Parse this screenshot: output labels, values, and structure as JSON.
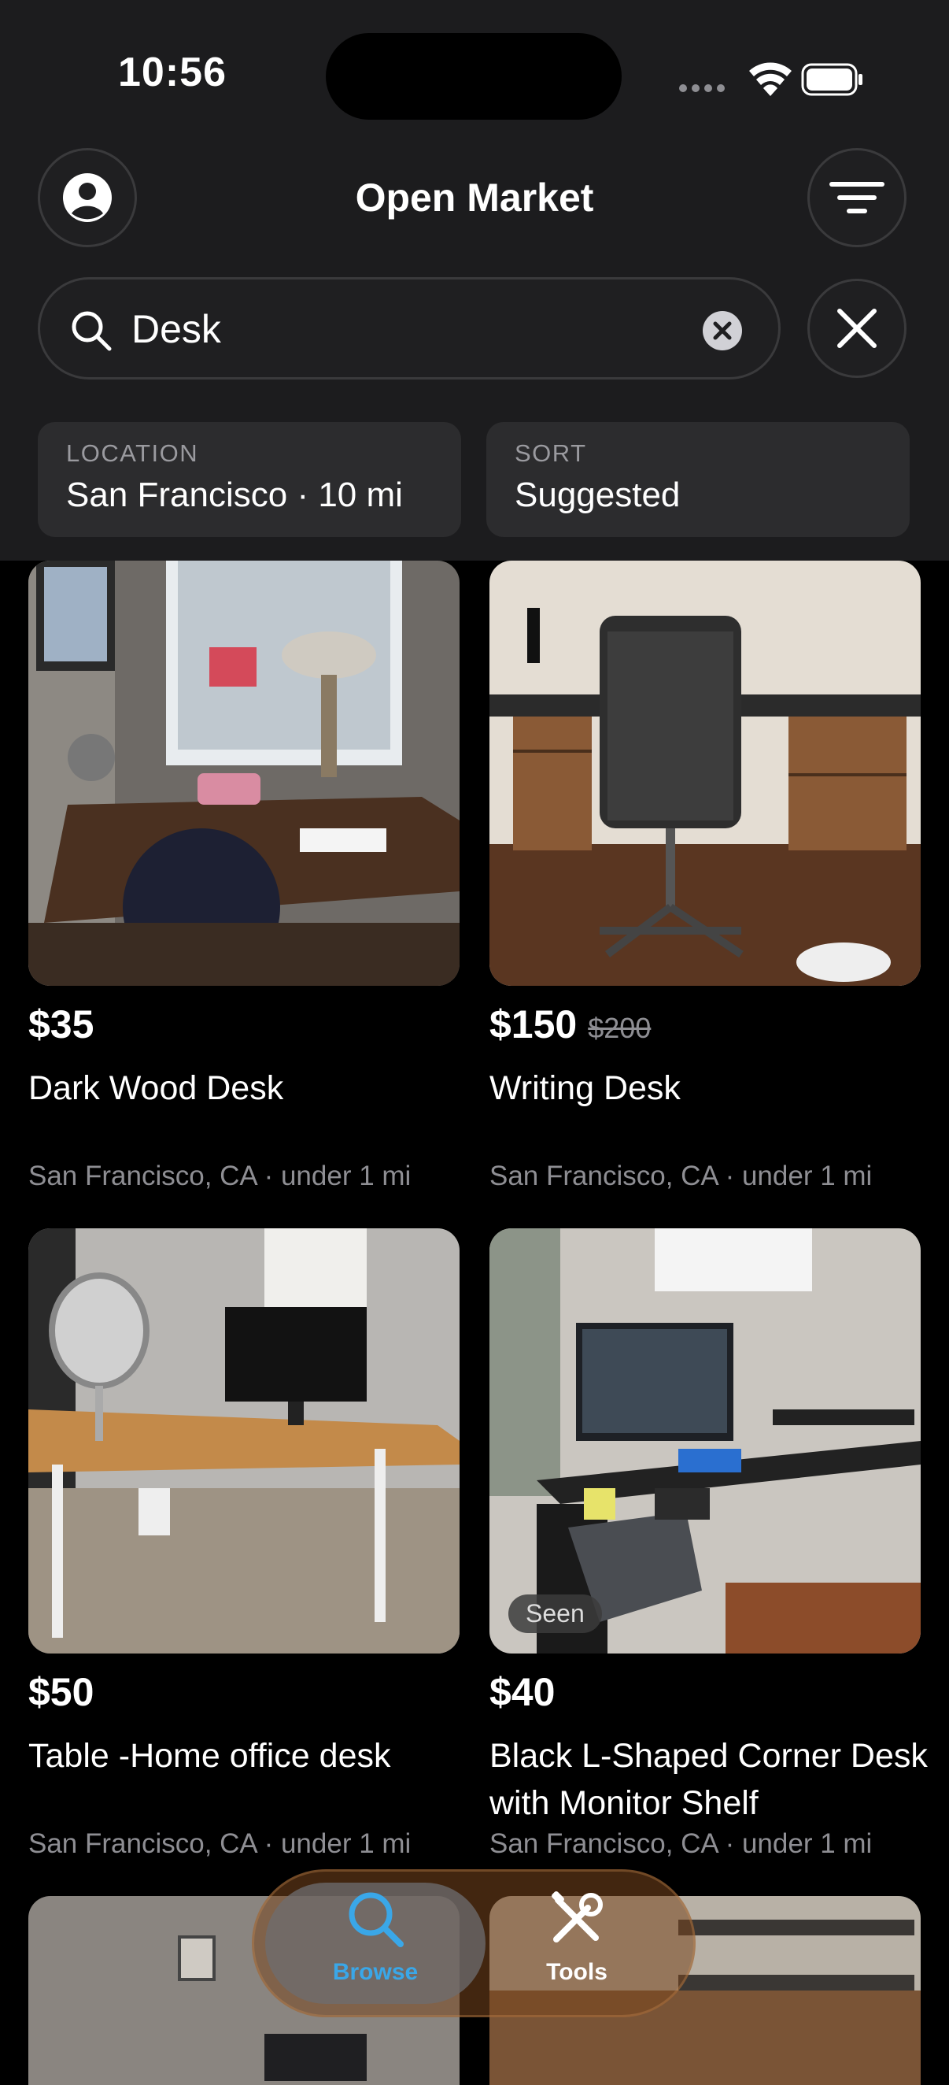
{
  "status_bar": {
    "time": "10:56"
  },
  "header": {
    "title": "Open Market"
  },
  "search": {
    "value": "Desk"
  },
  "filters": {
    "location_label": "LOCATION",
    "location_value": "San Francisco · 10 mi",
    "sort_label": "SORT",
    "sort_value": "Suggested"
  },
  "listings": [
    {
      "price": "$35",
      "name": "Dark Wood Desk",
      "location": "San Francisco, CA",
      "distance": "under 1 mi"
    },
    {
      "price": "$150",
      "old_price": "$200",
      "name": "Writing Desk",
      "location": "San Francisco, CA",
      "distance": "under 1 mi"
    },
    {
      "price": "$50",
      "name": "Table -Home office desk",
      "location": "San Francisco, CA",
      "distance": "under 1 mi"
    },
    {
      "price": "$40",
      "name": "Black L-Shaped Corner Desk with Monitor Shelf",
      "location": "San Francisco, CA",
      "distance": "under 1 mi",
      "badge": "Seen"
    }
  ],
  "tabs": {
    "browse": "Browse",
    "tools": "Tools"
  },
  "colors": {
    "accent": "#3aa7e8",
    "header_bg": "#1c1c1e",
    "background": "#000000"
  }
}
